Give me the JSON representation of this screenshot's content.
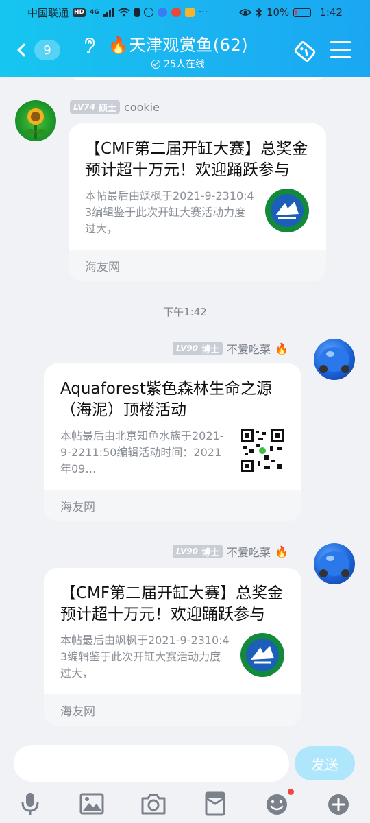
{
  "status_bar": {
    "carrier": "中国联通",
    "hd": "HD",
    "net": "4G",
    "battery": "10%",
    "time": "1:42"
  },
  "nav": {
    "back_count": "9",
    "title_emoji": "🔥",
    "title": "天津观赏鱼(62)",
    "online": "25人在线"
  },
  "messages": [
    {
      "level": "LV74",
      "rank": "硕士",
      "sender": "cookie",
      "card_title": "【CMF第二届开缸大赛】总奖金预计超十万元！欢迎踊跃参与",
      "card_desc": "本帖最后由飒枫于2021-9-2310:43编辑鉴于此次开缸大赛活动力度过大，",
      "card_source": "海友网",
      "thumb": "club-logo-icon"
    },
    {
      "time": "下午1:42"
    },
    {
      "level": "LV90",
      "rank": "博士",
      "sender": "不爱吃菜",
      "sender_emoji": "🔥",
      "card_title": "Aquaforest紫色森林生命之源（海泥）顶楼活动",
      "card_desc": "本帖最后由北京知鱼水族于2021-9-2211:50编辑活动时间：2021年09…",
      "card_source": "海友网",
      "thumb": "qr-code-icon"
    },
    {
      "level": "LV90",
      "rank": "博士",
      "sender": "不爱吃菜",
      "sender_emoji": "🔥",
      "card_title": "【CMF第二届开缸大赛】总奖金预计超十万元！欢迎踊跃参与",
      "card_desc": "本帖最后由飒枫于2021-9-2310:43编辑鉴于此次开缸大赛活动力度过大，",
      "card_source": "海友网",
      "thumb": "club-logo-icon"
    }
  ],
  "input": {
    "value": "",
    "send_label": "发送"
  },
  "toolbar": [
    "microphone-icon",
    "image-icon",
    "camera-icon",
    "red-packet-icon",
    "emoji-icon",
    "plus-icon"
  ],
  "colors": {
    "header": "#1bb3f1",
    "send_disabled": "#aee6fb",
    "badge": "#c9ced6"
  }
}
